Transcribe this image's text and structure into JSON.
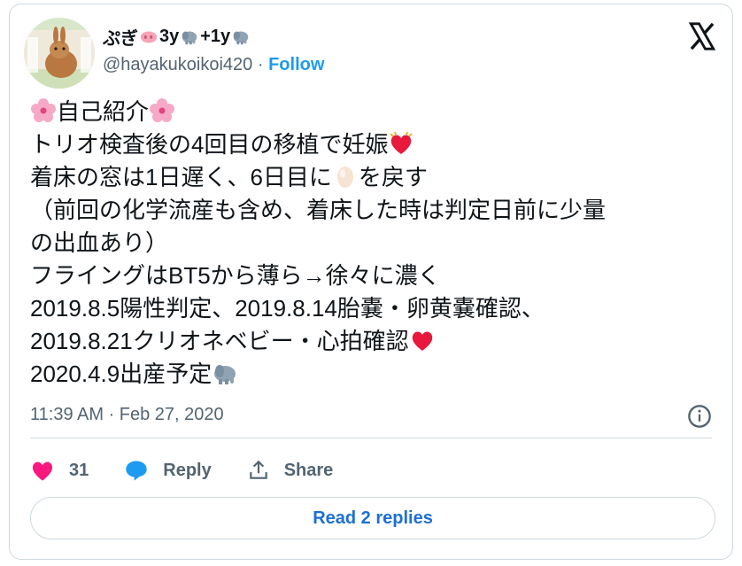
{
  "author": {
    "display_name_prefix": "ぷぎ",
    "display_name_part2": "3y",
    "display_name_part3": "+1y",
    "handle": "@hayakukoikoi420",
    "separator": " · ",
    "follow_label": "Follow"
  },
  "tweet": {
    "lines": [
      "自己紹介",
      "トリオ検査後の4回目の移植で妊娠",
      "着床の窓は1日遅く、6日目に",
      "を戻す",
      "（前回の化学流産も含め、着床した時は判定日前に少量",
      "の出血あり）",
      "フライングはBT5から薄ら→徐々に濃く",
      "2019.8.5陽性判定、2019.8.14胎嚢・卵黄嚢確認、",
      "2019.8.21クリオネベビー・心拍確認",
      "2020.4.9出産予定"
    ],
    "timestamp": "11:39 AM · Feb 27, 2020"
  },
  "actions": {
    "like_count": "31",
    "reply_label": "Reply",
    "share_label": "Share"
  },
  "read_replies_label": "Read 2 replies",
  "colors": {
    "accent": "#1d9bf0",
    "like": "#f91880",
    "text": "#0f1419",
    "muted": "#536471",
    "border": "#cfd9de"
  }
}
